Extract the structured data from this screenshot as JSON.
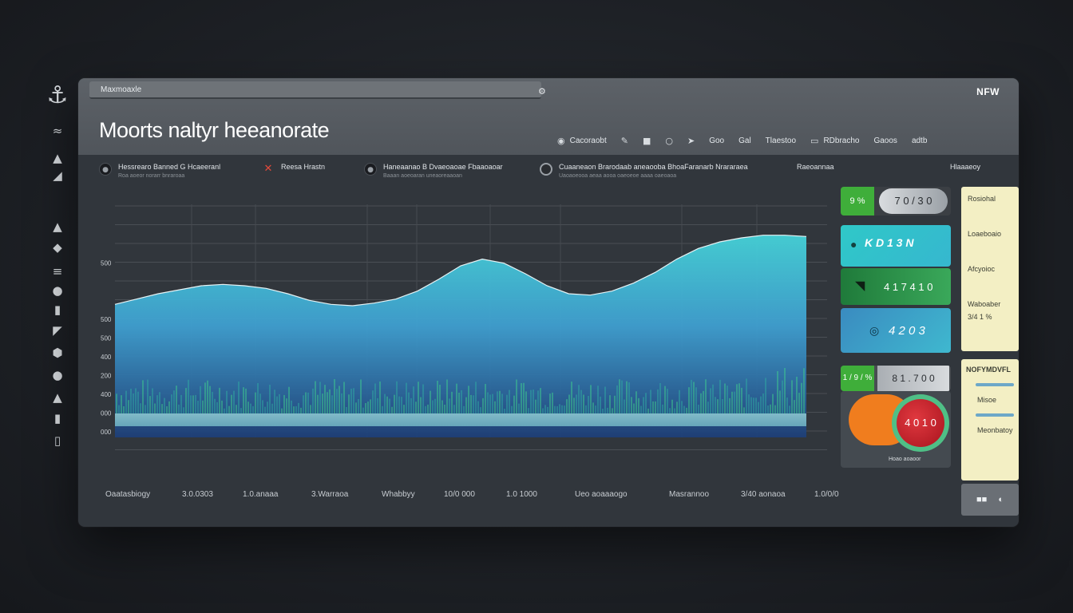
{
  "app": {
    "window_title": "Maxmoaxle",
    "page_title": "Moorts naltyr heeanorate",
    "brand_tag": "NFW",
    "title_icon": "gear-icon"
  },
  "left_rail": {
    "items": [
      {
        "icon": "anchor-icon",
        "glyph": "⚓"
      },
      {
        "icon": "wave-icon",
        "glyph": "≈"
      },
      {
        "icon": "triangle-icon",
        "glyph": "▲"
      },
      {
        "icon": "pointer-icon",
        "glyph": "◢"
      },
      {
        "icon": "cone-icon",
        "glyph": "▲"
      },
      {
        "icon": "shape-icon",
        "glyph": "◆"
      },
      {
        "icon": "stack-icon",
        "glyph": "≡"
      },
      {
        "icon": "bubble-icon",
        "glyph": "●"
      },
      {
        "icon": "chart-icon",
        "glyph": "▮"
      },
      {
        "icon": "bird-icon",
        "glyph": "◤"
      },
      {
        "icon": "hex-icon",
        "glyph": "⬢"
      },
      {
        "icon": "drop-icon",
        "glyph": "●"
      },
      {
        "icon": "tree-icon",
        "glyph": "▲"
      },
      {
        "icon": "flag-icon",
        "glyph": "▮"
      },
      {
        "icon": "doc-icon",
        "glyph": "▯"
      }
    ]
  },
  "toolbar": {
    "items": [
      {
        "label": "Cacoraobt",
        "icon": "record-icon",
        "glyph": "◉"
      },
      {
        "label": "",
        "icon": "pencil-icon",
        "glyph": "✎"
      },
      {
        "label": "",
        "icon": "square-icon",
        "glyph": "■"
      },
      {
        "label": "",
        "icon": "circle-icon",
        "glyph": "○"
      },
      {
        "label": "",
        "icon": "arrow-icon",
        "glyph": "➤"
      },
      {
        "label": "Goo",
        "icon": "",
        "glyph": ""
      },
      {
        "label": "Gal",
        "icon": "",
        "glyph": ""
      },
      {
        "label": "Tlaestoo",
        "icon": "",
        "glyph": ""
      },
      {
        "label": "RDbracho",
        "icon": "monitor-icon",
        "glyph": "▭"
      },
      {
        "label": "Gaoos",
        "icon": "",
        "glyph": ""
      },
      {
        "label": "adtb",
        "icon": "",
        "glyph": ""
      }
    ]
  },
  "filters": [
    {
      "line1": "Hessrearo Banned  G  Hcaeeranl",
      "line2": "Roa aoeor norarr bnraroaa",
      "badge": "eye-icon",
      "glyph": "●",
      "style": "dark"
    },
    {
      "line1": "Reesa Hrastn",
      "line2": "",
      "badge": "close-icon",
      "glyph": "✕",
      "style": "red"
    },
    {
      "line1": "Haneaanao B  Dvaeoaoae  Fbaaoaoar",
      "line2": "Baaan aoeoaran uneaoreaaoan",
      "badge": "shield-icon",
      "glyph": "●",
      "style": "dark"
    },
    {
      "line1": "Cuaaneaon Brarodaab aneaooba BhoaFaranarb Nrararaea",
      "line2": "Uaoaoeooa aeaa aooa oaeoeoe aaaa oaeoaoa",
      "badge": "clock-icon",
      "glyph": "◷",
      "style": "ring"
    },
    {
      "line1": "Raeoannaa",
      "line2": "",
      "badge": "",
      "glyph": "",
      "style": "none"
    },
    {
      "line1": "Hlaaaeoy",
      "line2": "",
      "badge": "",
      "glyph": "",
      "style": "none"
    }
  ],
  "chart_data": {
    "type": "area",
    "title": "",
    "xlabel": "",
    "ylabel": "",
    "y_tick_labels": [
      "",
      "",
      "",
      "500",
      "",
      "",
      "500",
      "500",
      "400",
      "200",
      "400",
      "000",
      "000",
      ""
    ],
    "x_tick_labels": [
      "Oaatasbiogy",
      "3.0.0303",
      "1.0.anaaa",
      "3.Warraoa",
      "Whabbyy",
      "10/0 000",
      "1.0 1000",
      "Ueo aoaaaogo",
      "Masrannoo",
      "3/40 aonaoa",
      "1.0/0/0"
    ],
    "series": [
      {
        "values": [
          58,
          62,
          66,
          69,
          72,
          73,
          72,
          70,
          66,
          61,
          58,
          57,
          59,
          62,
          68,
          77,
          87,
          92,
          89,
          81,
          72,
          66,
          65,
          68,
          74,
          82,
          92,
          100,
          105,
          108,
          110,
          110,
          109
        ]
      }
    ],
    "ylim": [
      0,
      120
    ],
    "grid": true,
    "legend": "none"
  },
  "stats": {
    "card1": {
      "label": "9 %",
      "value": "7 0 / 3 0"
    },
    "card2": {
      "label": "K D 1 3 N"
    },
    "card3": {
      "label": "4 1 7  4 1 0"
    },
    "card4": {
      "label": "4 2 0 3"
    },
    "card5": {
      "label": "1 / 9 / %",
      "value": "8 1 . 7 0 0"
    },
    "card6": {
      "value": "4 0 1 0",
      "footer": "Hoao aoaoor"
    }
  },
  "side_panel": {
    "items": [
      "Rosiohal",
      "Loaeboaio",
      "Afcyoioc",
      "Waboaber",
      "3/4 1 %"
    ]
  },
  "side_panel_2": {
    "title": "NOFYMDVFL",
    "items": [
      "Misoe",
      "Meonbatoy"
    ]
  },
  "bottom_ctrl": {
    "left": "■■",
    "right": "◐"
  },
  "colors": {
    "accent_green": "#3fae3a",
    "accent_teal": "#3ec8d0",
    "accent_red": "#c8232f",
    "accent_orange": "#f07d1e",
    "panel_yellow": "#f3efc4"
  }
}
